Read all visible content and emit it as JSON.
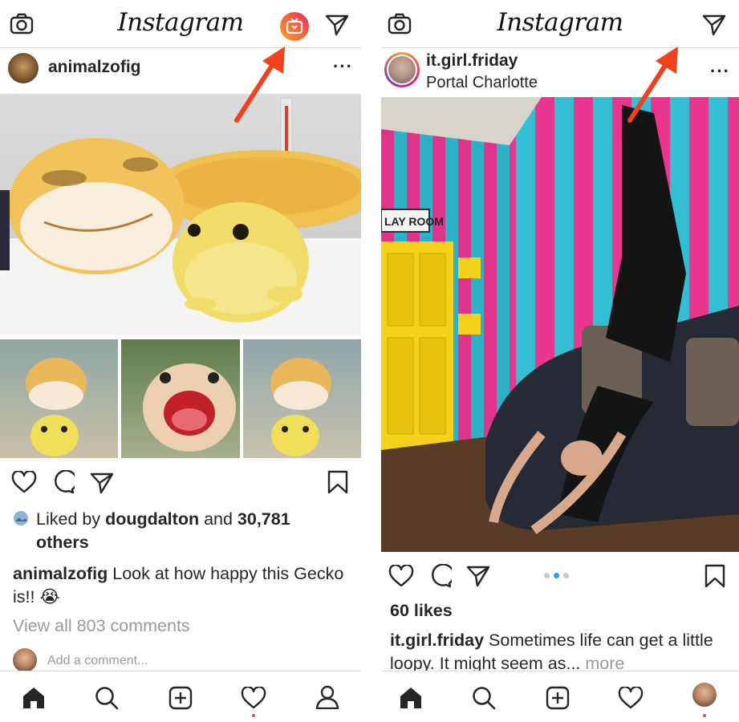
{
  "left": {
    "app_title": "Instagram",
    "post": {
      "username": "animalzofig",
      "liked_by_prefix": "Liked by ",
      "liked_by_user": "dougdalton",
      "liked_by_and": " and ",
      "liked_by_count": "30,781",
      "liked_by_others": "others",
      "caption_user": "animalzofig",
      "caption_text": " Look at how happy this Gecko is!! 😭",
      "view_comments": "View all 803 comments",
      "add_comment_placeholder": "Add a comment..."
    },
    "icons": [
      "camera-icon",
      "igtv-icon",
      "direct-icon",
      "more-icon",
      "heart-icon",
      "comment-icon",
      "share-icon",
      "bookmark-icon",
      "home-icon",
      "search-icon",
      "add-icon",
      "activity-icon",
      "profile-icon"
    ]
  },
  "right": {
    "app_title": "Instagram",
    "post": {
      "username": "it.girl.friday",
      "location": "Portal Charlotte",
      "likes": "60 likes",
      "caption_user": "it.girl.friday",
      "caption_text": " Sometimes life can get a little loopy. It might seem as...",
      "more_link": "more",
      "carousel_pages": 3,
      "carousel_active": 2
    },
    "icons": [
      "camera-icon",
      "direct-icon",
      "more-icon",
      "heart-icon",
      "comment-icon",
      "share-icon",
      "bookmark-icon",
      "home-icon",
      "search-icon",
      "add-icon",
      "activity-icon",
      "profile-avatar"
    ]
  },
  "colors": {
    "text": "#262626",
    "muted": "#9a9a9a",
    "border": "#dbdbdb",
    "arrow": "#f0401e",
    "notification": "#ed4956",
    "carousel_active": "#3897f0"
  }
}
